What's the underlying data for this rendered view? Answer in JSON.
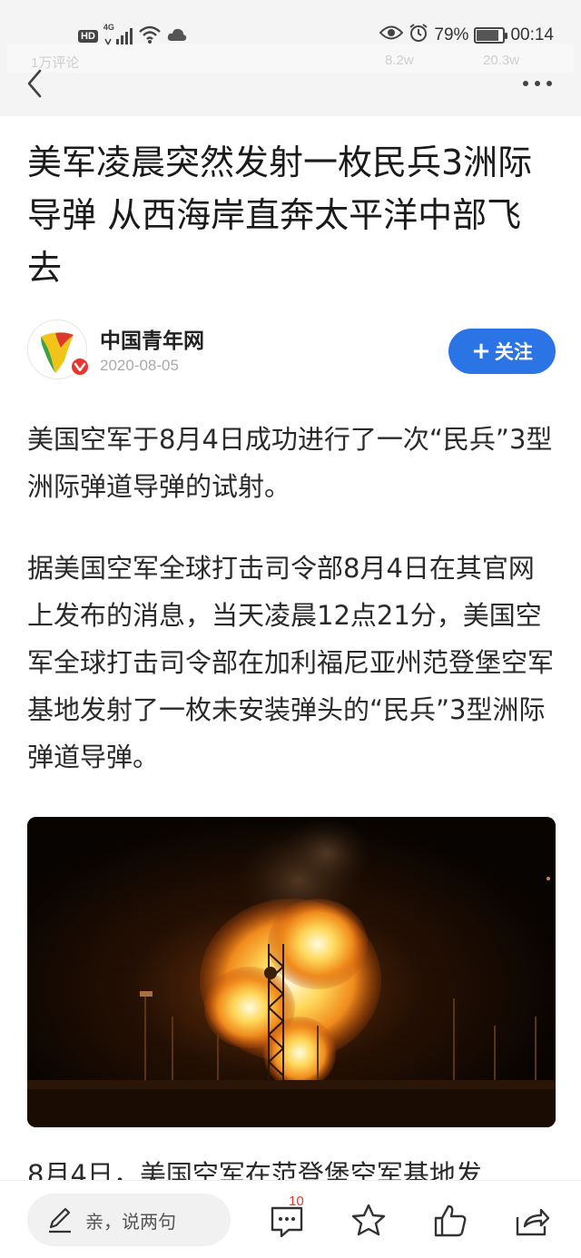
{
  "status_bar": {
    "hd": "HD",
    "network": "4G",
    "battery_text": "79%",
    "battery_level": 0.79,
    "time": "00:14"
  },
  "ghost": {
    "left_text": "1万评论",
    "mid_text": "8.2w",
    "right_text": "20.3w"
  },
  "article": {
    "title": "美军凌晨突然发射一枚民兵3洲际导弹 从西海岸直奔太平洋中部飞去",
    "author": "中国青年网",
    "date": "2020-08-05",
    "follow_label": "关注",
    "paragraphs": [
      "美国空军于8月4日成功进行了一次“民兵”3型洲际弹道导弹的试射。",
      "据美国空军全球打击司令部8月4日在其官网上发布的消息，当天凌晨12点21分，美国空军全球打击司令部在加利福尼亚州范登堡空军基地发射了一枚未安装弹头的“民兵”3型洲际弹道导弹。",
      "8月4日，美国空军在范登堡空军基地发"
    ]
  },
  "bottom_bar": {
    "comment_placeholder": "亲，说两句",
    "comment_count": "10"
  },
  "colors": {
    "accent": "#2a74e6",
    "verified_badge": "#e8352d",
    "status_bg": "#f4f4f4"
  },
  "icons": [
    "back-icon",
    "more-icon",
    "edit-icon",
    "comment-icon",
    "star-icon",
    "thumbs-up-icon",
    "share-icon",
    "eye-icon",
    "alarm-icon",
    "wifi-icon",
    "cloud-icon",
    "signal-icon",
    "battery-icon"
  ]
}
